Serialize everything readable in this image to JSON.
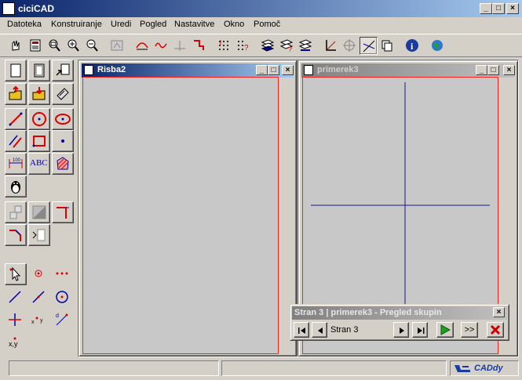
{
  "app": {
    "title": "ciciCAD"
  },
  "menu": [
    "Datoteka",
    "Konstruiranje",
    "Uredi",
    "Pogled",
    "Nastavitve",
    "Okno",
    "Pomoč"
  ],
  "windows": [
    {
      "title": "Risba2"
    },
    {
      "title": "primerek3"
    }
  ],
  "navigator": {
    "title": "Stran 3 | primerek3 - Pregled skupin",
    "page_label": "Stran 3",
    "more_label": ">>"
  },
  "toolbox": {
    "text_tool_label": "ABC",
    "coord_label": "x,y"
  },
  "statusbar": {
    "logo_text": "CADdy"
  },
  "colors": {
    "title_active": "#0a246a",
    "canvas_bg": "#c8c8c8",
    "canvas_border": "#ff2020",
    "drawing_lines": "#1a1a8c"
  }
}
